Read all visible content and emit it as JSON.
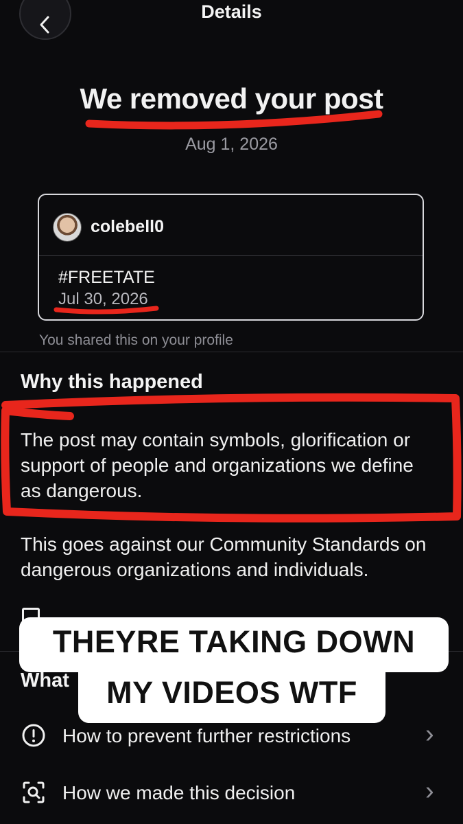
{
  "nav": {
    "title": "Details",
    "back_icon": "chevron-left-icon"
  },
  "header": {
    "title": "We removed your post",
    "date": "Aug 1, 2026"
  },
  "post_card": {
    "username": "colebell0",
    "caption": "#FREETATE",
    "date": "Jul 30, 2026"
  },
  "shared_note": "You shared this on your profile",
  "why": {
    "heading": "Why this happened",
    "reason": "The post may contain symbols, glorification or support of people and organizations we define as dangerous.",
    "standards": "This goes against our Community Standards on dangerous organizations and individuals."
  },
  "actions": [
    {
      "label": "How to prevent further restrictions",
      "icon": "info-circle-icon"
    },
    {
      "label": "How we made this decision",
      "icon": "scan-search-icon"
    }
  ],
  "overlay": {
    "line1": "THEYRE TAKING DOWN",
    "line2": "MY VIDEOS WTF",
    "partial_heading": "What"
  },
  "colors": {
    "background": "#0b0b0d",
    "annotation_red": "#e8261c",
    "muted_text": "#9b9ba2"
  }
}
